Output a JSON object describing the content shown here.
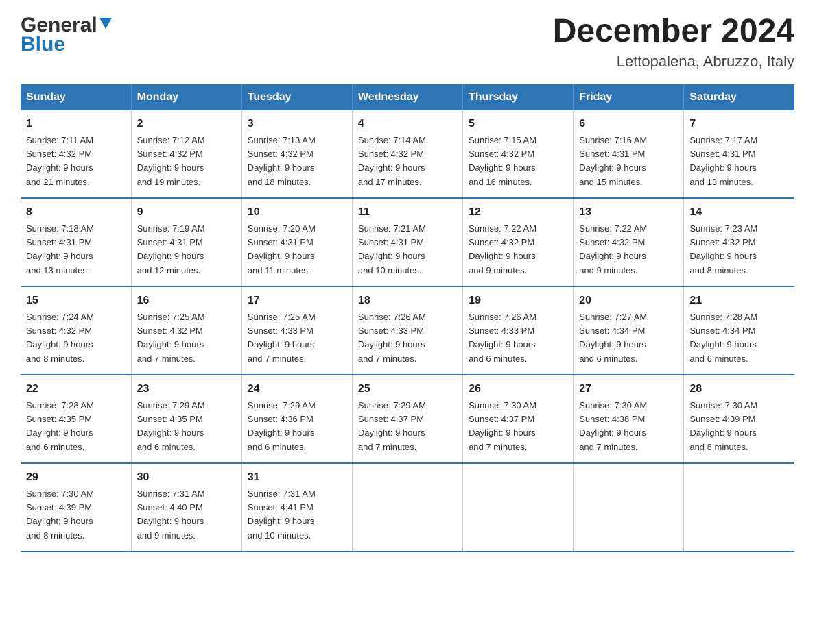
{
  "logo": {
    "general": "General",
    "blue": "Blue"
  },
  "title": "December 2024",
  "subtitle": "Lettopalena, Abruzzo, Italy",
  "days_header": [
    "Sunday",
    "Monday",
    "Tuesday",
    "Wednesday",
    "Thursday",
    "Friday",
    "Saturday"
  ],
  "weeks": [
    [
      {
        "day": "1",
        "sunrise": "7:11 AM",
        "sunset": "4:32 PM",
        "daylight": "9 hours and 21 minutes."
      },
      {
        "day": "2",
        "sunrise": "7:12 AM",
        "sunset": "4:32 PM",
        "daylight": "9 hours and 19 minutes."
      },
      {
        "day": "3",
        "sunrise": "7:13 AM",
        "sunset": "4:32 PM",
        "daylight": "9 hours and 18 minutes."
      },
      {
        "day": "4",
        "sunrise": "7:14 AM",
        "sunset": "4:32 PM",
        "daylight": "9 hours and 17 minutes."
      },
      {
        "day": "5",
        "sunrise": "7:15 AM",
        "sunset": "4:32 PM",
        "daylight": "9 hours and 16 minutes."
      },
      {
        "day": "6",
        "sunrise": "7:16 AM",
        "sunset": "4:31 PM",
        "daylight": "9 hours and 15 minutes."
      },
      {
        "day": "7",
        "sunrise": "7:17 AM",
        "sunset": "4:31 PM",
        "daylight": "9 hours and 13 minutes."
      }
    ],
    [
      {
        "day": "8",
        "sunrise": "7:18 AM",
        "sunset": "4:31 PM",
        "daylight": "9 hours and 13 minutes."
      },
      {
        "day": "9",
        "sunrise": "7:19 AM",
        "sunset": "4:31 PM",
        "daylight": "9 hours and 12 minutes."
      },
      {
        "day": "10",
        "sunrise": "7:20 AM",
        "sunset": "4:31 PM",
        "daylight": "9 hours and 11 minutes."
      },
      {
        "day": "11",
        "sunrise": "7:21 AM",
        "sunset": "4:31 PM",
        "daylight": "9 hours and 10 minutes."
      },
      {
        "day": "12",
        "sunrise": "7:22 AM",
        "sunset": "4:32 PM",
        "daylight": "9 hours and 9 minutes."
      },
      {
        "day": "13",
        "sunrise": "7:22 AM",
        "sunset": "4:32 PM",
        "daylight": "9 hours and 9 minutes."
      },
      {
        "day": "14",
        "sunrise": "7:23 AM",
        "sunset": "4:32 PM",
        "daylight": "9 hours and 8 minutes."
      }
    ],
    [
      {
        "day": "15",
        "sunrise": "7:24 AM",
        "sunset": "4:32 PM",
        "daylight": "9 hours and 8 minutes."
      },
      {
        "day": "16",
        "sunrise": "7:25 AM",
        "sunset": "4:32 PM",
        "daylight": "9 hours and 7 minutes."
      },
      {
        "day": "17",
        "sunrise": "7:25 AM",
        "sunset": "4:33 PM",
        "daylight": "9 hours and 7 minutes."
      },
      {
        "day": "18",
        "sunrise": "7:26 AM",
        "sunset": "4:33 PM",
        "daylight": "9 hours and 7 minutes."
      },
      {
        "day": "19",
        "sunrise": "7:26 AM",
        "sunset": "4:33 PM",
        "daylight": "9 hours and 6 minutes."
      },
      {
        "day": "20",
        "sunrise": "7:27 AM",
        "sunset": "4:34 PM",
        "daylight": "9 hours and 6 minutes."
      },
      {
        "day": "21",
        "sunrise": "7:28 AM",
        "sunset": "4:34 PM",
        "daylight": "9 hours and 6 minutes."
      }
    ],
    [
      {
        "day": "22",
        "sunrise": "7:28 AM",
        "sunset": "4:35 PM",
        "daylight": "9 hours and 6 minutes."
      },
      {
        "day": "23",
        "sunrise": "7:29 AM",
        "sunset": "4:35 PM",
        "daylight": "9 hours and 6 minutes."
      },
      {
        "day": "24",
        "sunrise": "7:29 AM",
        "sunset": "4:36 PM",
        "daylight": "9 hours and 6 minutes."
      },
      {
        "day": "25",
        "sunrise": "7:29 AM",
        "sunset": "4:37 PM",
        "daylight": "9 hours and 7 minutes."
      },
      {
        "day": "26",
        "sunrise": "7:30 AM",
        "sunset": "4:37 PM",
        "daylight": "9 hours and 7 minutes."
      },
      {
        "day": "27",
        "sunrise": "7:30 AM",
        "sunset": "4:38 PM",
        "daylight": "9 hours and 7 minutes."
      },
      {
        "day": "28",
        "sunrise": "7:30 AM",
        "sunset": "4:39 PM",
        "daylight": "9 hours and 8 minutes."
      }
    ],
    [
      {
        "day": "29",
        "sunrise": "7:30 AM",
        "sunset": "4:39 PM",
        "daylight": "9 hours and 8 minutes."
      },
      {
        "day": "30",
        "sunrise": "7:31 AM",
        "sunset": "4:40 PM",
        "daylight": "9 hours and 9 minutes."
      },
      {
        "day": "31",
        "sunrise": "7:31 AM",
        "sunset": "4:41 PM",
        "daylight": "9 hours and 10 minutes."
      },
      null,
      null,
      null,
      null
    ]
  ],
  "labels": {
    "sunrise": "Sunrise:",
    "sunset": "Sunset:",
    "daylight": "Daylight:"
  }
}
